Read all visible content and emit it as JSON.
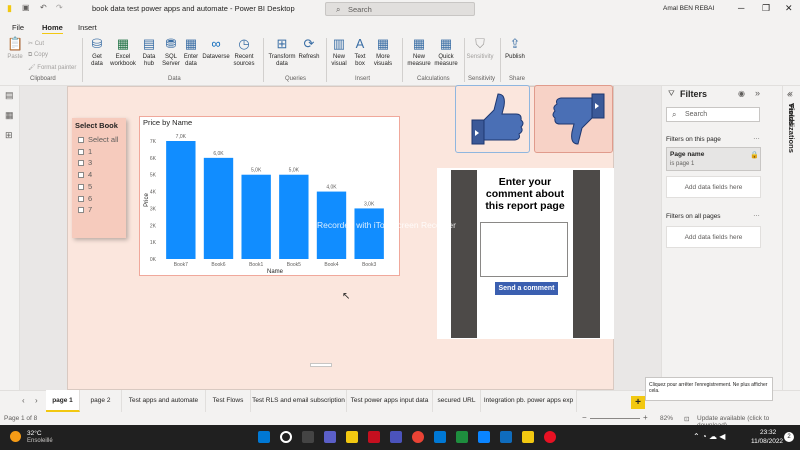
{
  "app": {
    "title": "book data test power apps and automate - Power BI Desktop",
    "search_placeholder": "Search",
    "user": "Amal BEN REBAI"
  },
  "menu": {
    "file": "File",
    "home": "Home",
    "insert": "Insert"
  },
  "ribbon": {
    "clipboard": {
      "paste": "Paste",
      "cut": "Cut",
      "copy": "Copy",
      "format_painter": "Format painter",
      "group": "Clipboard"
    },
    "data": {
      "get_data": "Get data",
      "excel": "Excel workbook",
      "data_hub": "Data hub",
      "sql": "SQL Server",
      "enter_data": "Enter data",
      "dataverse": "Dataverse",
      "recent": "Recent sources",
      "group": "Data"
    },
    "queries": {
      "transform": "Transform data",
      "refresh": "Refresh",
      "group": "Queries"
    },
    "insert": {
      "new_visual": "New visual",
      "text_box": "Text box",
      "more_visuals": "More visuals",
      "group": "Insert"
    },
    "calculations": {
      "new_measure": "New measure",
      "quick_measure": "Quick measure",
      "group": "Calculations"
    },
    "sensitivity": {
      "label": "Sensitivity",
      "group": "Sensitivity"
    },
    "share": {
      "publish": "Publish",
      "group": "Share"
    }
  },
  "slicer": {
    "title": "Select Book",
    "items": [
      "Select all",
      "1",
      "3",
      "4",
      "5",
      "6",
      "7"
    ]
  },
  "chart_data": {
    "type": "bar",
    "title": "Price by Name",
    "xlabel": "Name",
    "ylabel": "Price",
    "categories": [
      "Book7",
      "Book6",
      "Book1",
      "Book5",
      "Book4",
      "Book3"
    ],
    "values": [
      7000,
      6000,
      5000,
      5000,
      4000,
      3000
    ],
    "data_labels": [
      "7,0K",
      "6,0K",
      "5,0K",
      "5,0K",
      "4,0K",
      "3,0K"
    ],
    "y_ticks": [
      "0K",
      "1K",
      "2K",
      "3K",
      "4K",
      "5K",
      "6K",
      "7K"
    ],
    "ylim": [
      0,
      7000
    ],
    "bar_color": "#118dff"
  },
  "comment_app": {
    "title": "Enter your comment about this report page",
    "send_label": "Send a comment"
  },
  "watermark": "Recorded with iTop Screen Recorder",
  "filters": {
    "title": "Filters",
    "search_placeholder": "Search",
    "on_this_page": "Filters on this page",
    "page_filter_name": "Page name",
    "page_filter_value": "is page 1",
    "add_fields": "Add data fields here",
    "on_all_pages": "Filters on all pages",
    "add_fields_2": "Add data fields here"
  },
  "side_panes": {
    "visualizations": "Visualizations",
    "fields": "Fields"
  },
  "tabs": [
    "page 1",
    "page 2",
    "Test apps and automate",
    "Test Flows",
    "Test RLS and email subscription",
    "Test power apps input data",
    "secured URL",
    "Integration pb. power apps exp C"
  ],
  "tooltip": "Cliquez pour arrêter l'enregistrement. Ne plus afficher cela.",
  "status": {
    "page": "Page 1 of 8",
    "zoom": "82%",
    "update": "Update available (click to download)"
  },
  "taskbar": {
    "temp": "32°C",
    "weather": "Ensoleillé",
    "time": "23:32",
    "date": "11/08/2022"
  },
  "colors": {
    "accent": "#f2c811",
    "bar": "#118dff",
    "canvas": "#fbe6dd"
  }
}
